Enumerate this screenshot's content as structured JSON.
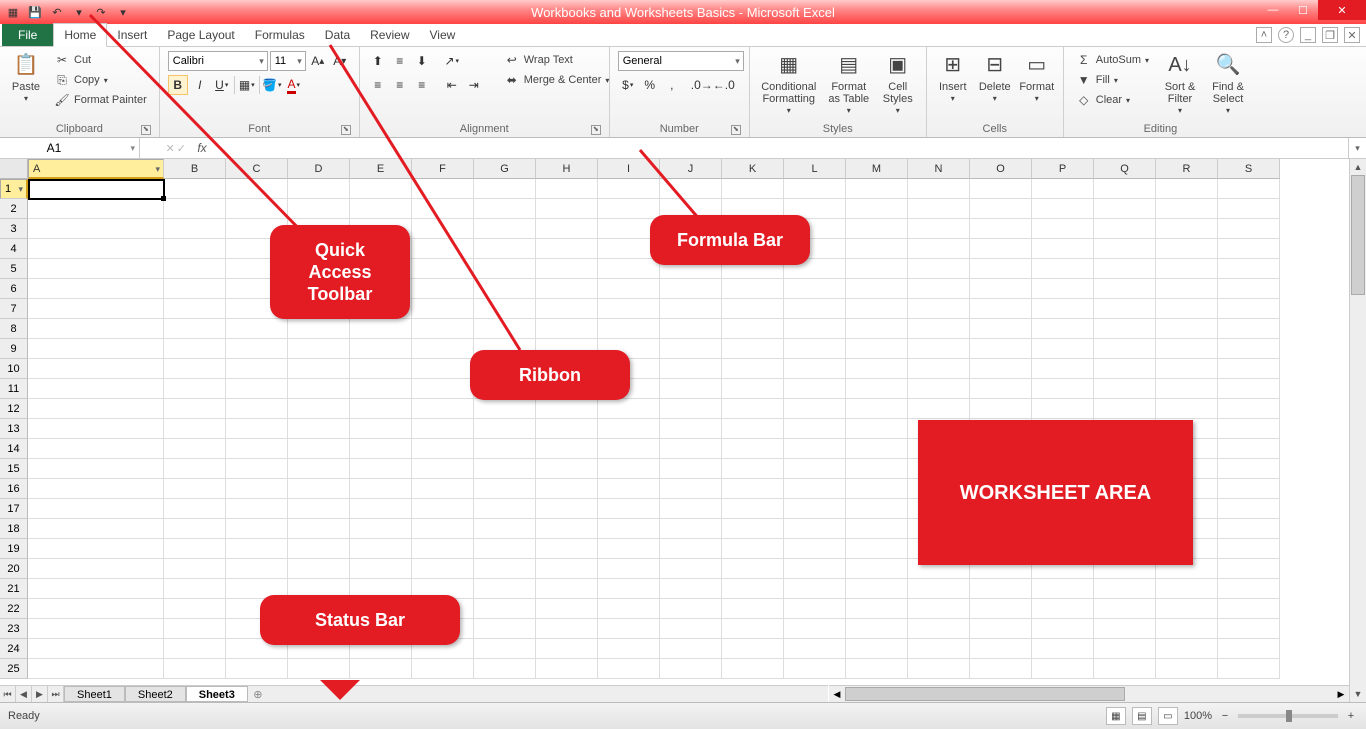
{
  "title": "Workbooks and Worksheets Basics - Microsoft Excel",
  "qat": {
    "save": "💾",
    "undo": "↶",
    "redo": "↷"
  },
  "tabs": {
    "file": "File",
    "home": "Home",
    "insert": "Insert",
    "page": "Page Layout",
    "formulas": "Formulas",
    "data": "Data",
    "review": "Review",
    "view": "View"
  },
  "ribbon": {
    "clipboard": {
      "label": "Clipboard",
      "paste": "Paste",
      "cut": "Cut",
      "copy": "Copy",
      "painter": "Format Painter"
    },
    "font": {
      "label": "Font",
      "name": "Calibri",
      "size": "11"
    },
    "alignment": {
      "label": "Alignment",
      "wrap": "Wrap Text",
      "merge": "Merge & Center"
    },
    "number": {
      "label": "Number",
      "format": "General"
    },
    "styles": {
      "label": "Styles",
      "cond": "Conditional Formatting",
      "table": "Format as Table",
      "cell": "Cell Styles"
    },
    "cells": {
      "label": "Cells",
      "insert": "Insert",
      "delete": "Delete",
      "format": "Format"
    },
    "editing": {
      "label": "Editing",
      "autosum": "AutoSum",
      "fill": "Fill",
      "clear": "Clear",
      "sort": "Sort & Filter",
      "find": "Find & Select"
    }
  },
  "namebox": "A1",
  "columns": [
    "A",
    "B",
    "C",
    "D",
    "E",
    "F",
    "G",
    "H",
    "I",
    "J",
    "K",
    "L",
    "M",
    "N",
    "O",
    "P",
    "Q",
    "R",
    "S"
  ],
  "rows": [
    "1",
    "2",
    "3",
    "4",
    "5",
    "6",
    "7",
    "8",
    "9",
    "10",
    "11",
    "12",
    "13",
    "14",
    "15",
    "16",
    "17",
    "18",
    "19",
    "20",
    "21",
    "22",
    "23",
    "24",
    "25"
  ],
  "sheets": {
    "s1": "Sheet1",
    "s2": "Sheet2",
    "s3": "Sheet3"
  },
  "status": {
    "ready": "Ready",
    "zoom": "100%"
  },
  "callouts": {
    "qat": "Quick Access Toolbar",
    "ribbon": "Ribbon",
    "fbar": "Formula Bar",
    "status": "Status Bar",
    "ws": "WORKSHEET AREA"
  }
}
